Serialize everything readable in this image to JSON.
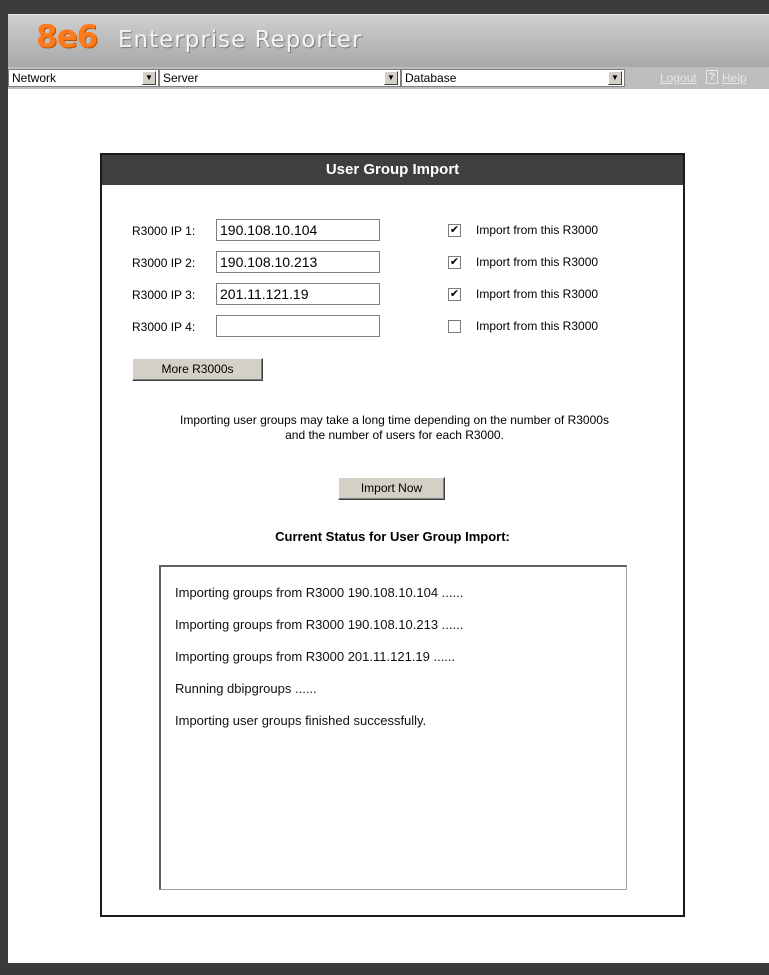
{
  "app": {
    "logo": "8e6",
    "title": "Enterprise Reporter"
  },
  "selectors": {
    "network": "Network",
    "server": "Server",
    "database": "Database",
    "arrow": "▼"
  },
  "links": {
    "logout": "Logout",
    "help_icon": "?",
    "help": "Help"
  },
  "panel": {
    "title": "User Group Import",
    "rows": [
      {
        "label": "R3000 IP 1:",
        "value": "190.108.10.104",
        "checked": true,
        "check_label": "Import from this R3000"
      },
      {
        "label": "R3000 IP 2:",
        "value": "190.108.10.213",
        "checked": true,
        "check_label": "Import from this R3000"
      },
      {
        "label": "R3000 IP 3:",
        "value": "201.11.121.19",
        "checked": true,
        "check_label": "Import from this R3000"
      },
      {
        "label": "R3000 IP 4:",
        "value": "",
        "checked": false,
        "check_label": "Import from this R3000"
      }
    ],
    "more_button": "More R3000s",
    "note_line1": "Importing user groups may take a long time depending on the number of R3000s",
    "note_line2": "and the number of users for each R3000.",
    "import_button": "Import Now",
    "status_heading": "Current Status for User Group Import:",
    "status_lines": [
      "Importing groups from R3000 190.108.10.104 ......",
      "Importing groups from R3000 190.108.10.213 ......",
      "Importing groups from R3000 201.11.121.19 ......",
      "Running dbipgroups ......",
      "Importing user groups finished successfully."
    ]
  }
}
